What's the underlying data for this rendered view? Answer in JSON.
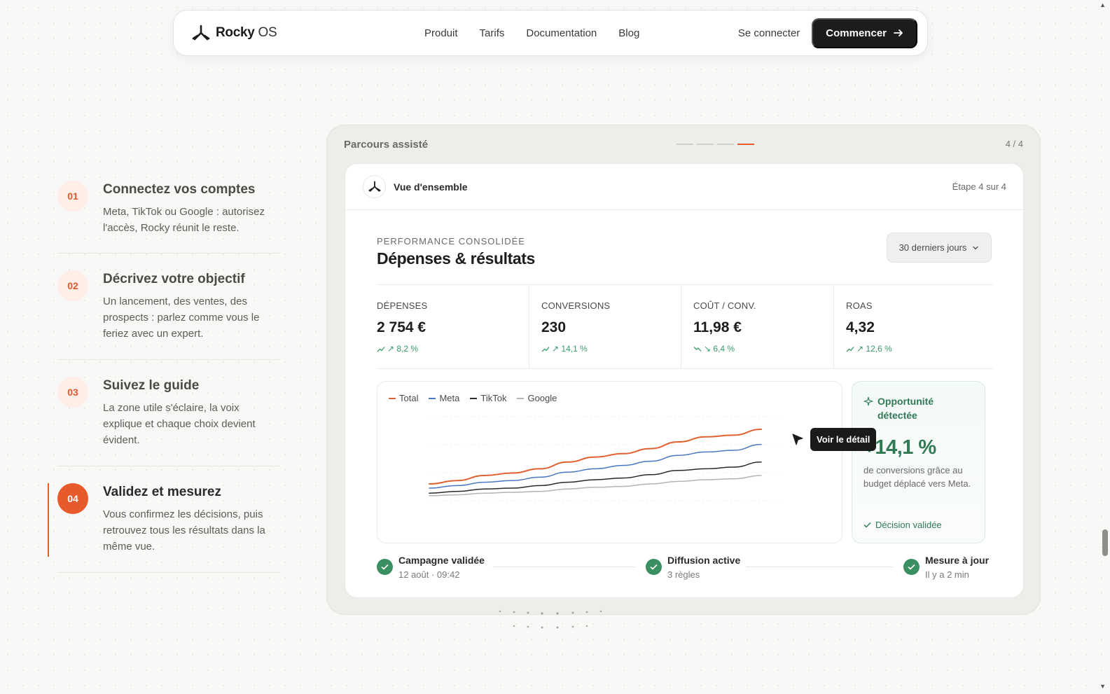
{
  "nav": {
    "brand_main": "Rocky",
    "brand_suffix": "OS",
    "links": [
      "Produit",
      "Tarifs",
      "Documentation",
      "Blog"
    ],
    "login": "Se connecter",
    "cta": "Commencer"
  },
  "steps": [
    {
      "num": "01",
      "title": "Connectez vos comptes",
      "desc": "Meta, TikTok ou Google : autorisez l'accès, Rocky réunit le reste."
    },
    {
      "num": "02",
      "title": "Décrivez votre objectif",
      "desc": "Un lancement, des ventes, des prospects : parlez comme vous le feriez avec un expert."
    },
    {
      "num": "03",
      "title": "Suivez le guide",
      "desc": "La zone utile s'éclaire, la voix explique et chaque choix devient évident."
    },
    {
      "num": "04",
      "title": "Validez et mesurez",
      "desc": "Vous confirmez les décisions, puis retrouvez tous les résultats dans la même vue."
    }
  ],
  "panel": {
    "title": "Parcours assisté",
    "count": "4 / 4",
    "progress_total": 4,
    "progress_current": 4
  },
  "card": {
    "head_title": "Vue d'ensemble",
    "head_step": "Étape 4 sur 4",
    "eyebrow": "PERFORMANCE CONSOLIDÉE",
    "title": "Dépenses & résultats",
    "range": "30 derniers jours"
  },
  "kpis": [
    {
      "label": "DÉPENSES",
      "value": "2 754 €",
      "delta": "↗ 8,2 %",
      "trend": "up"
    },
    {
      "label": "CONVERSIONS",
      "value": "230",
      "delta": "↗ 14,1 %",
      "trend": "up"
    },
    {
      "label": "COÛT / CONV.",
      "value": "11,98 €",
      "delta": "↘ 6,4 %",
      "trend": "down"
    },
    {
      "label": "ROAS",
      "value": "4,32",
      "delta": "↗ 12,6 %",
      "trend": "up"
    }
  ],
  "chart_data": {
    "type": "line",
    "x": [
      0,
      1,
      2,
      3,
      4,
      5,
      6,
      7,
      8,
      9,
      10,
      11,
      12
    ],
    "series": [
      {
        "name": "Total",
        "color": "#e0602f",
        "values": [
          20,
          24,
          30,
          33,
          38,
          46,
          52,
          56,
          62,
          70,
          76,
          78,
          85
        ]
      },
      {
        "name": "Meta",
        "color": "#4a78c2",
        "values": [
          15,
          18,
          22,
          24,
          28,
          34,
          38,
          42,
          47,
          54,
          58,
          60,
          67
        ]
      },
      {
        "name": "TikTok",
        "color": "#2a2a28",
        "values": [
          9,
          11,
          14,
          15,
          18,
          22,
          25,
          27,
          31,
          36,
          38,
          40,
          46
        ]
      },
      {
        "name": "Google",
        "color": "#b4b4b0",
        "values": [
          6,
          7,
          9,
          10,
          11,
          14,
          16,
          17,
          20,
          23,
          25,
          26,
          30
        ]
      }
    ],
    "ylim": [
      0,
      100
    ],
    "grid": true,
    "legend": "top-left"
  },
  "tooltip": "Voir le détail",
  "opportunity": {
    "title": "Opportunité détectée",
    "value": "+14,1 %",
    "text": "de conversions grâce au budget déplacé vers Meta.",
    "footer": "Décision validée"
  },
  "timeline": [
    {
      "title": "Campagne validée",
      "sub": "12 août · 09:42"
    },
    {
      "title": "Diffusion active",
      "sub": "3 règles"
    },
    {
      "title": "Mesure à jour",
      "sub": "Il y a 2 min"
    }
  ]
}
